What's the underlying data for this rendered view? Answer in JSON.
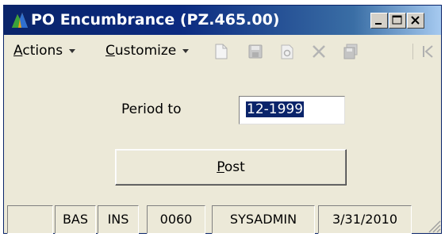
{
  "window": {
    "title": "PO Encumbrance (PZ.465.00)"
  },
  "toolbar": {
    "actions_label_underlined": "A",
    "actions_label_rest": "ctions",
    "customize_label_underlined": "C",
    "customize_label_rest": "ustomize",
    "icons": [
      "new-document-icon",
      "save-icon",
      "refresh-icon",
      "delete-icon",
      "save-all-icon",
      "first-record-icon"
    ]
  },
  "form": {
    "period_label": "Period to",
    "period_value": "12-1999",
    "post_label_underlined": "P",
    "post_label_rest": "ost"
  },
  "status_bar": {
    "fields": [
      "",
      "BAS",
      "INS",
      "0060",
      "SYSADMIN",
      "3/31/2010"
    ]
  },
  "colors": {
    "title_bar": "#0a246a",
    "window_face": "#ece9d8",
    "selection": "#0a246a"
  }
}
